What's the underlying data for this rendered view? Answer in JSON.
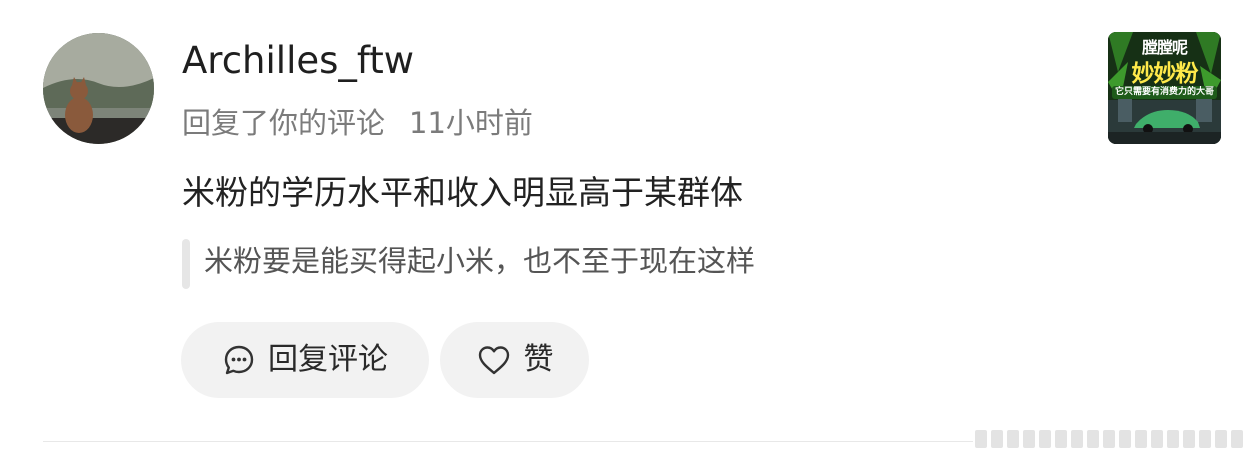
{
  "comment": {
    "username": "Archilles_ftw",
    "action_text": "回复了你的评论",
    "time": "11小时前",
    "reply_text": "米粉的学历水平和收入明显高于某群体",
    "quoted_text": "米粉要是能买得起小米，也不至于现在这样"
  },
  "actions": {
    "reply_label": "回复评论",
    "reply_icon": "comment-icon",
    "like_label": "赞",
    "like_icon": "heart-icon"
  },
  "thumbnail": {
    "title_top": "膛膛呢",
    "title_main": "妙妙粉",
    "subtitle": "它只需要有消费力的大哥"
  },
  "colors": {
    "username": "#1f1f1f",
    "meta": "#7b7b7b",
    "reply_text": "#222222",
    "quote_text": "#555555",
    "pill_bg": "#f2f2f2",
    "thumb_accent": "#ffe94a"
  }
}
